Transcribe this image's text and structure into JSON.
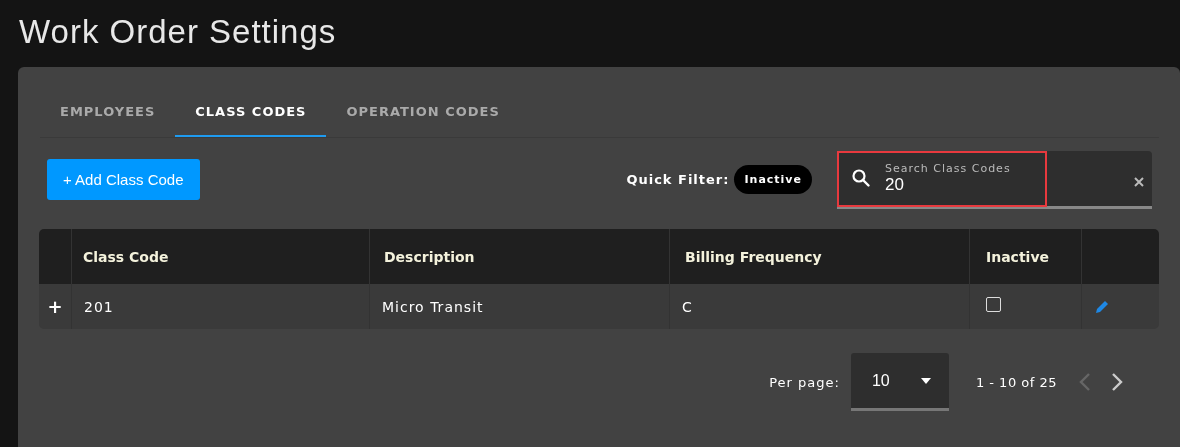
{
  "page_title": "Work Order Settings",
  "tabs": [
    {
      "label": "EMPLOYEES",
      "selected": false
    },
    {
      "label": "CLASS CODES",
      "selected": true
    },
    {
      "label": "OPERATION CODES",
      "selected": false
    }
  ],
  "add_button": "+ Add Class Code",
  "quick_filter": {
    "label": "Quick Filter:",
    "chips": [
      {
        "label": "Inactive",
        "selected": false
      }
    ]
  },
  "search": {
    "label": "Search Class Codes",
    "value": "20",
    "highlighted": true
  },
  "table": {
    "columns": [
      "Class Code",
      "Description",
      "Billing Frequency",
      "Inactive"
    ],
    "rows": [
      {
        "expand": "+",
        "cells": [
          "201",
          "Micro Transit",
          "C"
        ],
        "inactive": false
      }
    ]
  },
  "pagination": {
    "per_page_label": "Per page:",
    "per_page": "10",
    "range": "1 - 10 of 25",
    "prev_disabled": true,
    "next_disabled": false
  }
}
